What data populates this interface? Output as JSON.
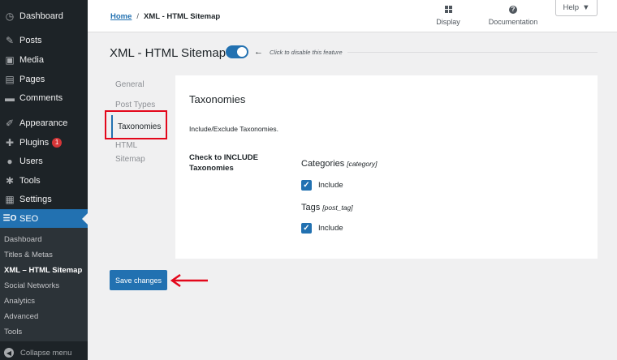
{
  "sidebar": {
    "items": [
      {
        "label": "Dashboard",
        "icon": "dashboard-icon",
        "glyph": "◷"
      },
      {
        "label": "Posts",
        "icon": "pin-icon",
        "glyph": "✎"
      },
      {
        "label": "Media",
        "icon": "media-icon",
        "glyph": "▣"
      },
      {
        "label": "Pages",
        "icon": "pages-icon",
        "glyph": "▤"
      },
      {
        "label": "Comments",
        "icon": "comments-icon",
        "glyph": "▬"
      },
      {
        "label": "Appearance",
        "icon": "brush-icon",
        "glyph": "✐"
      },
      {
        "label": "Plugins",
        "icon": "plugin-icon",
        "glyph": "✚",
        "badge": "1"
      },
      {
        "label": "Users",
        "icon": "user-icon",
        "glyph": "●"
      },
      {
        "label": "Tools",
        "icon": "wrench-icon",
        "glyph": "✱"
      },
      {
        "label": "Settings",
        "icon": "settings-icon",
        "glyph": "▦"
      }
    ],
    "seo": {
      "label": "SEO",
      "icon": "seo-icon",
      "glyph": "☰O"
    },
    "submenu": [
      "Dashboard",
      "Titles & Metas",
      "XML – HTML Sitemap",
      "Social Networks",
      "Analytics",
      "Advanced",
      "Tools"
    ],
    "collapse_label": "Collapse menu"
  },
  "topbar": {
    "breadcrumb_home": "Home",
    "breadcrumb_sep": "/",
    "breadcrumb_current": "XML - HTML Sitemap",
    "display_label": "Display",
    "docs_label": "Documentation",
    "help_label": "Help"
  },
  "header": {
    "title": "XML - HTML Sitemap",
    "toggle_hint": "Click to disable this feature",
    "toggle_on": true
  },
  "nav": {
    "general": "General",
    "post_types": "Post Types",
    "taxonomies": "Taxonomies",
    "html_sitemap_1": "HTML",
    "html_sitemap_2": "Sitemap"
  },
  "panel": {
    "title": "Taxonomies",
    "description": "Include/Exclude Taxonomies.",
    "row_label": "Check to INCLUDE Taxonomies",
    "taxonomies": [
      {
        "name": "Categories",
        "slug": "[category]",
        "checkbox_label": "Include",
        "checked": true
      },
      {
        "name": "Tags",
        "slug": "[post_tag]",
        "checkbox_label": "Include",
        "checked": true
      }
    ]
  },
  "save_label": "Save changes",
  "colors": {
    "accent": "#2271b1",
    "annotation": "#e3071b",
    "sidebar": "#1d2327"
  }
}
